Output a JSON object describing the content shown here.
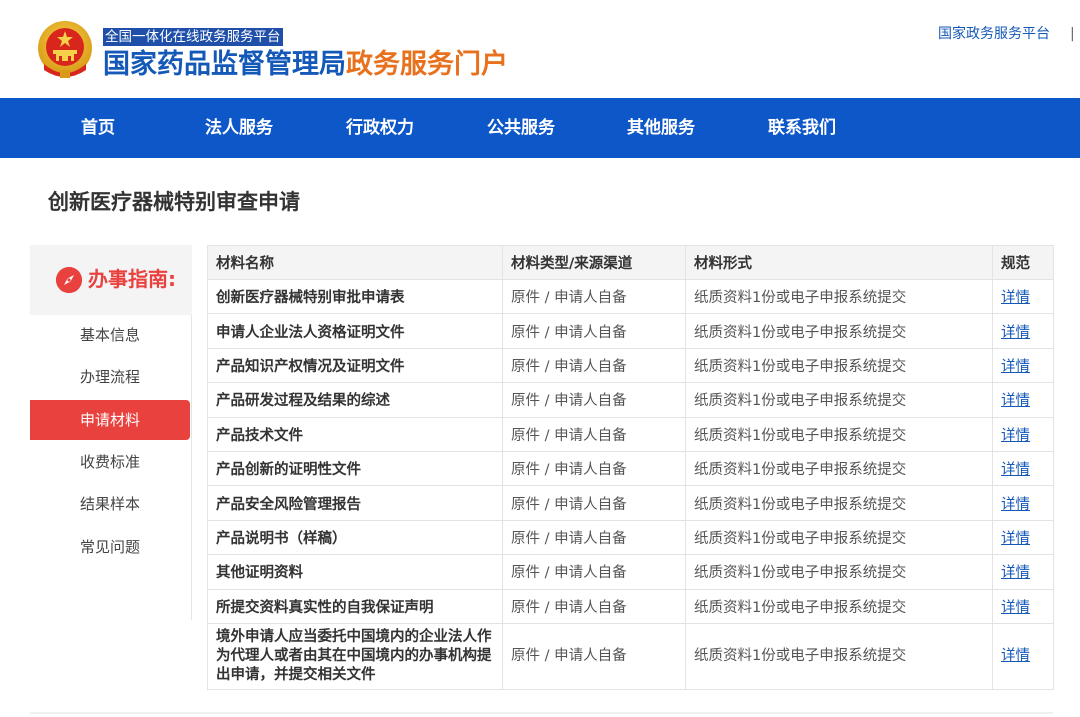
{
  "header": {
    "platform_tag": "全国一体化在线政务服务平台",
    "title_part1": "国家药品监督管理局",
    "title_part2": "政务服务门户",
    "top_link": "国家政务服务平台",
    "top_separator": "|"
  },
  "nav": {
    "items": [
      "首页",
      "法人服务",
      "行政权力",
      "公共服务",
      "其他服务",
      "联系我们"
    ]
  },
  "page": {
    "title": "创新医疗器械特别审查申请"
  },
  "sidebar": {
    "guide_title": "办事指南:",
    "items": [
      {
        "label": "基本信息",
        "active": false
      },
      {
        "label": "办理流程",
        "active": false
      },
      {
        "label": "申请材料",
        "active": true
      },
      {
        "label": "收费标准",
        "active": false
      },
      {
        "label": "结果样本",
        "active": false
      },
      {
        "label": "常见问题",
        "active": false
      }
    ]
  },
  "table": {
    "headers": [
      "材料名称",
      "材料类型/来源渠道",
      "材料形式",
      "规范"
    ],
    "rows": [
      {
        "name": "创新医疗器械特别审批申请表",
        "type": "原件 / 申请人自备",
        "form": "纸质资料1份或电子申报系统提交",
        "spec": "详情"
      },
      {
        "name": "申请人企业法人资格证明文件",
        "type": "原件 / 申请人自备",
        "form": "纸质资料1份或电子申报系统提交",
        "spec": "详情"
      },
      {
        "name": "产品知识产权情况及证明文件",
        "type": "原件 / 申请人自备",
        "form": "纸质资料1份或电子申报系统提交",
        "spec": "详情"
      },
      {
        "name": "产品研发过程及结果的综述",
        "type": "原件 / 申请人自备",
        "form": "纸质资料1份或电子申报系统提交",
        "spec": "详情"
      },
      {
        "name": "产品技术文件",
        "type": "原件 / 申请人自备",
        "form": "纸质资料1份或电子申报系统提交",
        "spec": "详情"
      },
      {
        "name": "产品创新的证明性文件",
        "type": "原件 / 申请人自备",
        "form": "纸质资料1份或电子申报系统提交",
        "spec": "详情"
      },
      {
        "name": "产品安全风险管理报告",
        "type": "原件 / 申请人自备",
        "form": "纸质资料1份或电子申报系统提交",
        "spec": "详情"
      },
      {
        "name": "产品说明书（样稿）",
        "type": "原件 / 申请人自备",
        "form": "纸质资料1份或电子申报系统提交",
        "spec": "详情"
      },
      {
        "name": "其他证明资料",
        "type": "原件 / 申请人自备",
        "form": "纸质资料1份或电子申报系统提交",
        "spec": "详情"
      },
      {
        "name": "所提交资料真实性的自我保证声明",
        "type": "原件 / 申请人自备",
        "form": "纸质资料1份或电子申报系统提交",
        "spec": "详情"
      },
      {
        "name": "境外申请人应当委托中国境内的企业法人作为代理人或者由其在中国境内的办事机构提出申请，并提交相关文件",
        "type": "原件 / 申请人自备",
        "form": "纸质资料1份或电子申报系统提交",
        "spec": "详情"
      }
    ]
  },
  "colors": {
    "brand_blue": "#0d57c9",
    "title_blue": "#1458b8",
    "title_orange": "#e8711d",
    "accent_red": "#e9413e"
  },
  "icons": {
    "emblem": "national-emblem-icon",
    "guide": "compass-icon"
  }
}
